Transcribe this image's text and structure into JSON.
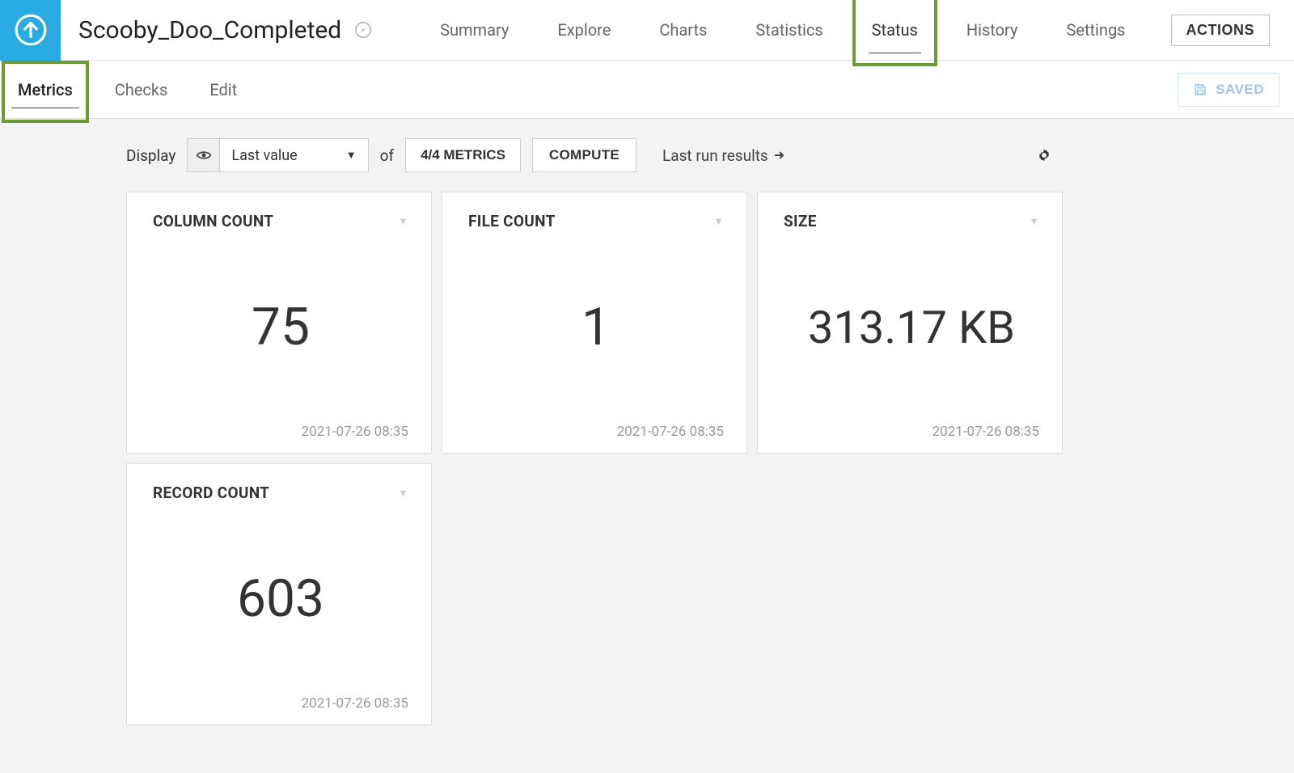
{
  "header": {
    "title": "Scooby_Doo_Completed",
    "tabs": [
      {
        "label": "Summary",
        "active": false
      },
      {
        "label": "Explore",
        "active": false
      },
      {
        "label": "Charts",
        "active": false
      },
      {
        "label": "Statistics",
        "active": false
      },
      {
        "label": "Status",
        "active": true,
        "highlighted": true
      },
      {
        "label": "History",
        "active": false
      },
      {
        "label": "Settings",
        "active": false
      }
    ],
    "actions_label": "ACTIONS"
  },
  "subheader": {
    "tabs": [
      {
        "label": "Metrics",
        "active": true,
        "highlighted": true
      },
      {
        "label": "Checks",
        "active": false
      },
      {
        "label": "Edit",
        "active": false
      }
    ],
    "saved_label": "SAVED"
  },
  "toolbar": {
    "display_label": "Display",
    "display_mode": "Last value",
    "of_label": "of",
    "metrics_count": "4/4 METRICS",
    "compute_label": "COMPUTE",
    "last_run_label": "Last run results"
  },
  "cards": [
    {
      "title": "COLUMN COUNT",
      "value": "75",
      "timestamp": "2021-07-26 08:35"
    },
    {
      "title": "FILE COUNT",
      "value": "1",
      "timestamp": "2021-07-26 08:35"
    },
    {
      "title": "SIZE",
      "value": "313.17 KB",
      "timestamp": "2021-07-26 08:35"
    },
    {
      "title": "RECORD COUNT",
      "value": "603",
      "timestamp": "2021-07-26 08:35"
    }
  ]
}
